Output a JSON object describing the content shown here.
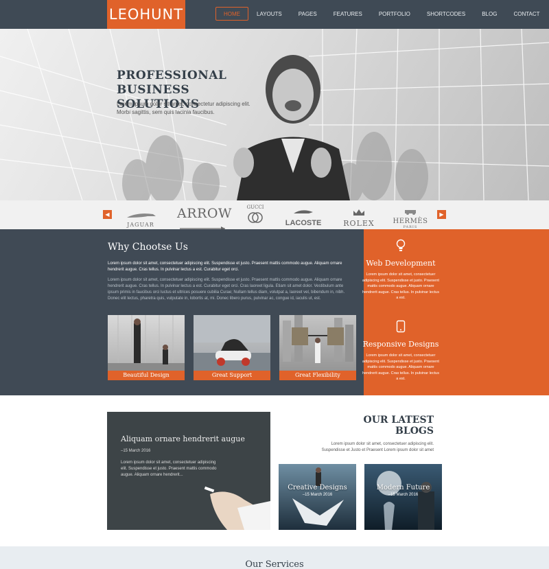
{
  "nav": {
    "logo": "LEOHUNT",
    "items": [
      "HOME",
      "LAYOUTS",
      "PAGES",
      "FEATURES",
      "PORTFOLIO",
      "SHORTCODES",
      "BLOG",
      "CONTACT"
    ],
    "active": "HOME"
  },
  "hero": {
    "title_line1": "PROFESSIONAL",
    "title_line2": "BUSINESS SOLUTIONS",
    "text": "Lorem ipsum dolor sit amet, consectetur adipiscing elit. Morbi sagittis, sem quis lacinia faucibus."
  },
  "brands": [
    "JAGUAR",
    "ARROW",
    "GUCCI",
    "LACOSTE",
    "ROLEX",
    "HERMÈS"
  ],
  "brand_sub": {
    "hermes": "PARIS"
  },
  "why": {
    "title": "Why Chootse Us",
    "p1": "Lorem ipsum dolor sit amet, consectetuer adipiscing elit. Suspendisse et justo. Praesent mattis commodo augue. Aliquam ornare hendrerit augue. Cras tellus. In pulvinar lectus a est. Curabitur eget orci.",
    "p2": "Lorem ipsum dolor sit amet, consectetuer adipiscing elit. Suspendisse et justo. Praesent mattis commodo augue. Aliquam ornare hendrerit augue. Cras tellus. In pulvinar lectus a est. Curabitur eget orci. Cras laoreet ligula. Etiam sit amet dolor. Vestibulum ante ipsum primis in faucibus orci luctus et ultrices posuere cubilia Curae; Nullam tellus diam, volutpat a, laoreet vel, bibendum in, nibh. Donec elit lectus, pharetra quis, vulputate in, lobortis at, mi. Donec libero purus, pulvinar ac, congue id, iaculis ut, est.",
    "cards": [
      "Beautiful Design",
      "Great Support",
      "Great Flexibility"
    ]
  },
  "side": {
    "services": [
      {
        "title": "Web Development",
        "icon": "lightbulb-icon",
        "text": "Lorem ipsum dolor sit amet, consectetuer adipiscing elit. Suspendisse et justo. Praesent mattis commodo augue. Aliquam ornare hendrerit augue. Cras tellus. In pulvinar lectus a est."
      },
      {
        "title": "Responsive Designs",
        "icon": "tablet-icon",
        "text": "Lorem ipsum dolor sit amet, consectetuer adipiscing elit. Suspendisse et justo. Praesent mattis commodo augue. Aliquam ornare hendrerit augue. Cras tellus. In pulvinar lectus a est."
      }
    ]
  },
  "blog_feature": {
    "title": "Aliquam ornare hendrerit augue",
    "date": "–15 March 2016",
    "text": "Lorem ipsum dolor sit amet, consectetuer adipiscing elit. Suspendisse et justo. Praesent mattis commodo augue. Aliquam ornare hendrerit..."
  },
  "latest": {
    "title_line1": "OUR LATEST",
    "title_line2": "BLOGS",
    "text": "Lorem ipsum dolor sit amet, consectetuer adipiscing elit. Suspendisse et Justo et Praesent Lorem ipsum dolor sit amet",
    "posts": [
      {
        "title": "Creative Designs",
        "date": "–15 March 2016"
      },
      {
        "title": "Modern Future",
        "date": "–15 March 2016"
      }
    ]
  },
  "services_strip": {
    "title": "Our Services"
  },
  "colors": {
    "accent": "#e0622a",
    "dark": "#404a55",
    "nav": "#3f4a55"
  }
}
